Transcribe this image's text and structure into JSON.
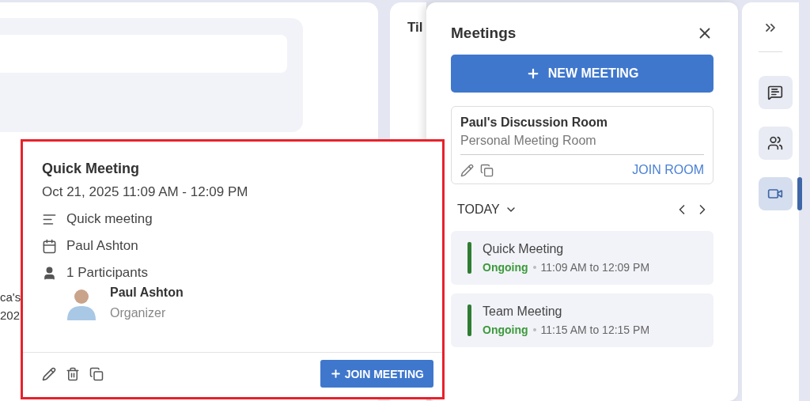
{
  "background": {
    "middle_heading": "Til",
    "snippet_lines": [
      "ca's",
      "202"
    ]
  },
  "meetings_panel": {
    "title": "Meetings",
    "new_button": "NEW MEETING",
    "room": {
      "name": "Paul's Discussion Room",
      "subtitle": "Personal Meeting Room",
      "join": "JOIN ROOM"
    },
    "day_filter": "TODAY",
    "meetings": [
      {
        "title": "Quick Meeting",
        "status": "Ongoing",
        "time": "11:09 AM to 12:09 PM"
      },
      {
        "title": "Team Meeting",
        "status": "Ongoing",
        "time": "11:15 AM to 12:15 PM"
      }
    ]
  },
  "rail": {
    "items": [
      {
        "kind": "chat",
        "selected": false
      },
      {
        "kind": "people",
        "selected": false
      },
      {
        "kind": "video",
        "selected": true
      }
    ]
  },
  "popup": {
    "title": "Quick Meeting",
    "datetime": "Oct 21, 2025 11:09 AM - 12:09 PM",
    "details": [
      {
        "kind": "description",
        "text": "Quick meeting"
      },
      {
        "kind": "calendar",
        "text": "Paul Ashton"
      },
      {
        "kind": "participants",
        "text": "1 Participants"
      }
    ],
    "participant": {
      "name": "Paul Ashton",
      "role": "Organizer"
    },
    "join_button": "JOIN MEETING"
  }
}
